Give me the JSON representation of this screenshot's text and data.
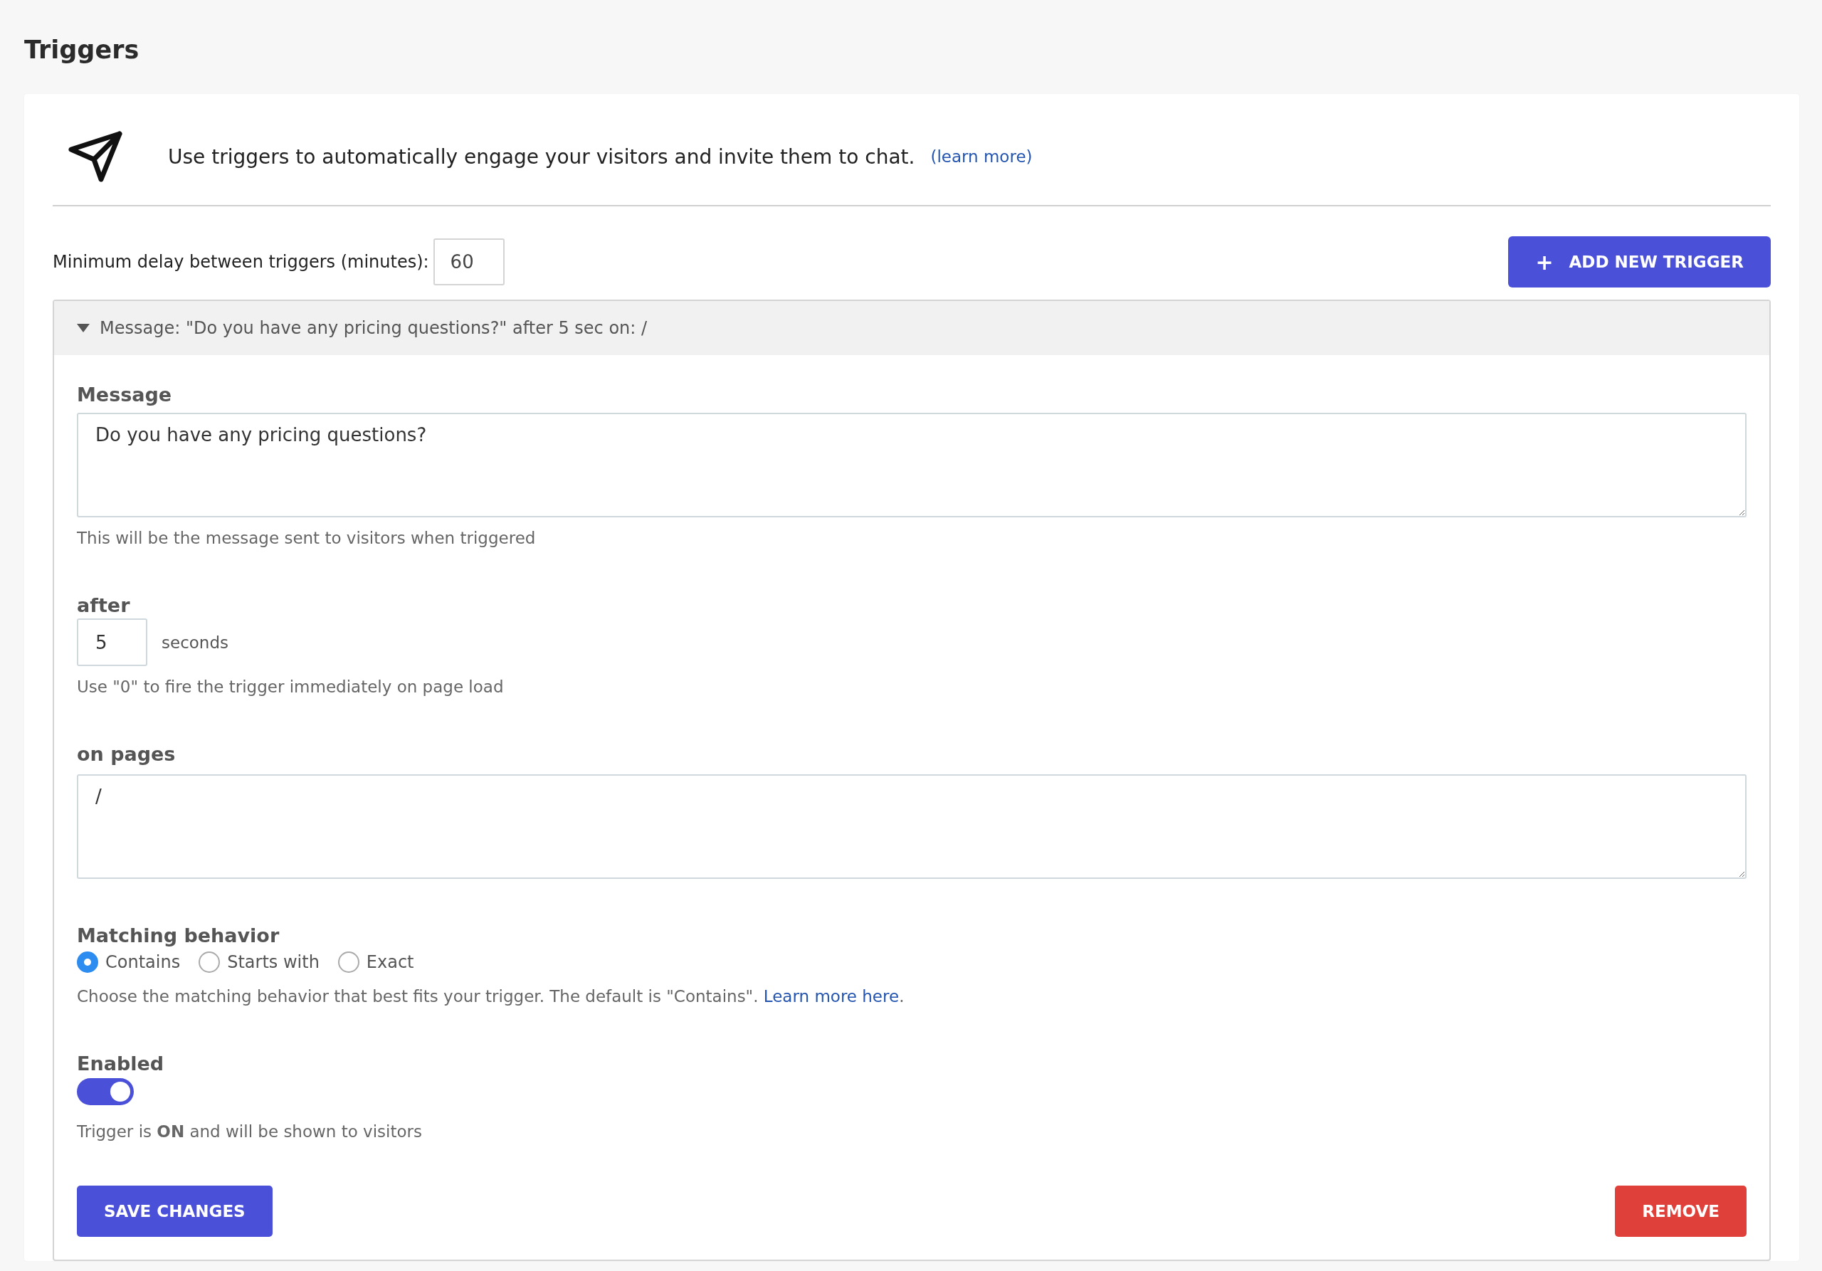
{
  "page_title": "Triggers",
  "intro": {
    "text": "Use triggers to automatically engage your visitors and invite them to chat.",
    "link": "(learn more)"
  },
  "min_delay": {
    "label": "Minimum delay between triggers (minutes):",
    "value": "60"
  },
  "add_button": {
    "label": "ADD NEW TRIGGER",
    "icon": "+"
  },
  "trigger": {
    "summary": "Message: \"Do you have any pricing questions?\" after 5 sec on: /",
    "expanded": true,
    "message": {
      "label": "Message",
      "value": "Do you have any pricing questions?",
      "help": "This will be the message sent to visitors when triggered"
    },
    "after": {
      "label": "after",
      "value": "5",
      "unit": "seconds",
      "help": "Use \"0\" to fire the trigger immediately on page load"
    },
    "pages": {
      "label": "on pages",
      "value": "/"
    },
    "matching": {
      "label": "Matching behavior",
      "options": [
        {
          "label": "Contains",
          "selected": true
        },
        {
          "label": "Starts with",
          "selected": false
        },
        {
          "label": "Exact",
          "selected": false
        }
      ],
      "help": "Choose the matching behavior that best fits your trigger. The default is \"Contains\". ",
      "link": "Learn more here",
      "help_end": "."
    },
    "enabled": {
      "label": "Enabled",
      "on": true,
      "status": "Trigger is **ON** and will be shown to visitors"
    },
    "save_button": "SAVE CHANGES",
    "remove_button": "REMOVE"
  }
}
